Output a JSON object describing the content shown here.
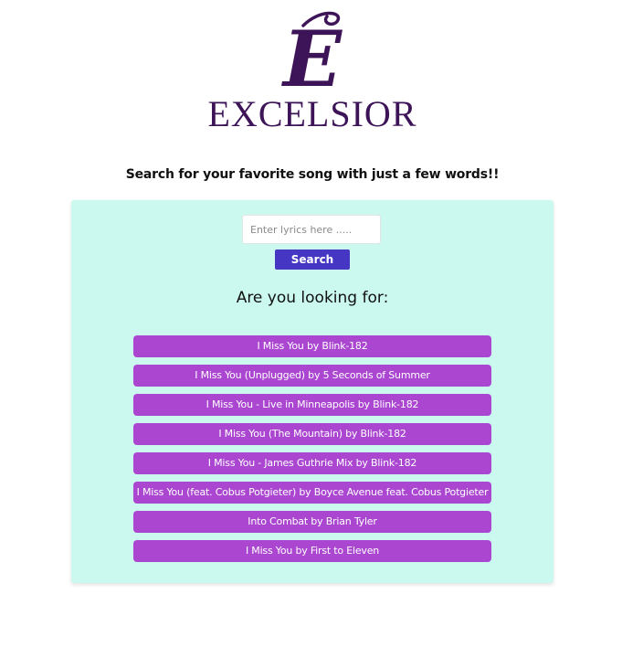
{
  "brand": {
    "monogram": "E",
    "name": "EXCELSIOR",
    "color": "#3d1457"
  },
  "tagline": "Search for your favorite song with just a few words!!",
  "search": {
    "placeholder": "Enter lyrics here .....",
    "value": "",
    "button_label": "Search"
  },
  "results": {
    "heading": "Are you looking for:",
    "items": [
      "I Miss You by Blink-182",
      "I Miss You (Unplugged) by 5 Seconds of Summer",
      "I Miss You - Live in Minneapolis by Blink-182",
      "I Miss You (The Mountain) by Blink-182",
      "I Miss You - James Guthrie Mix by Blink-182",
      "I Miss You (feat. Cobus Potgieter) by Boyce Avenue feat. Cobus Potgieter",
      "Into Combat by Brian Tyler",
      "I Miss You by First to Eleven"
    ]
  },
  "colors": {
    "panel": "#cbf9ef",
    "search_button": "#4537c4",
    "result_item": "#ab46d1"
  }
}
